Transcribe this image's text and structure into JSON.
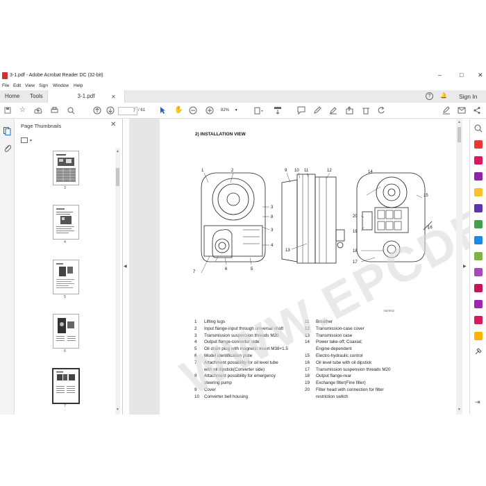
{
  "window": {
    "title": "3-1.pdf - Adobe Acrobat Reader DC (32-bit)",
    "controls": {
      "minimize": "–",
      "maximize": "□",
      "close": "✕"
    }
  },
  "menu": [
    "File",
    "Edit",
    "View",
    "Sign",
    "Window",
    "Help"
  ],
  "tabs": {
    "home": "Home",
    "tools": "Tools",
    "document": "3-1.pdf",
    "close": "✕"
  },
  "header_right": {
    "help": "?",
    "bell": "🔔",
    "signin": "Sign In"
  },
  "toolbar": {
    "page_current": "7",
    "page_total": "/ 61",
    "zoom": "82%"
  },
  "sidebar": {
    "title": "Page Thumbnails",
    "close": "✕",
    "thumbnails": [
      {
        "num": "3",
        "selected": false
      },
      {
        "num": "4",
        "selected": false
      },
      {
        "num": "5",
        "selected": false
      },
      {
        "num": "6",
        "selected": false
      },
      {
        "num": "7",
        "selected": true
      }
    ]
  },
  "document": {
    "heading": "2) INSTALLATION VIEW",
    "figure_note": "74079T02",
    "callouts_front": [
      "1",
      "2",
      "3",
      "8",
      "3",
      "4",
      "5",
      "6",
      "7"
    ],
    "callouts_side": [
      "9",
      "10",
      "11",
      "12",
      "13"
    ],
    "callouts_rear": [
      "14",
      "15",
      "16",
      "17",
      "18",
      "19",
      "20"
    ],
    "legend_left": [
      {
        "n": "1",
        "text": "Lifting lugs"
      },
      {
        "n": "2",
        "text": "Input flange-input through universal shaft"
      },
      {
        "n": "3",
        "text": "Transmission suspension threads M20"
      },
      {
        "n": "4",
        "text": "Output flange-converter side"
      },
      {
        "n": "5",
        "text": "Oil drain plug with magnetic insert M38×1.5"
      },
      {
        "n": "6",
        "text": "Model identification plate"
      },
      {
        "n": "7",
        "text": "Attachment possibility for oil level tube"
      },
      {
        "n": "",
        "text": "with oil dipstick(Converter side)"
      },
      {
        "n": "8",
        "text": "Attachment possibility for emergency"
      },
      {
        "n": "",
        "text": "steering pump"
      },
      {
        "n": "9",
        "text": "Cover"
      },
      {
        "n": "10",
        "text": "Converter bell housing"
      }
    ],
    "legend_right": [
      {
        "n": "11",
        "text": "Breather"
      },
      {
        "n": "12",
        "text": "Transmission-case cover"
      },
      {
        "n": "13",
        "text": "Transmission case"
      },
      {
        "n": "14",
        "text": "Power take-off; Coaxial;"
      },
      {
        "n": "",
        "text": "Engine-dependent"
      },
      {
        "n": "15",
        "text": "Electro-hydraulic control"
      },
      {
        "n": "16",
        "text": "Oil level tube with oil dipstick"
      },
      {
        "n": "17",
        "text": "Transmission suspension threads M20"
      },
      {
        "n": "18",
        "text": "Output flange-rear"
      },
      {
        "n": "19",
        "text": "Exchange filter(Fine filter)"
      },
      {
        "n": "20",
        "text": "Filter head with connection for filter"
      },
      {
        "n": "",
        "text": "restriction switch"
      }
    ]
  },
  "watermark": "WWW.EPCDEPO.COM"
}
